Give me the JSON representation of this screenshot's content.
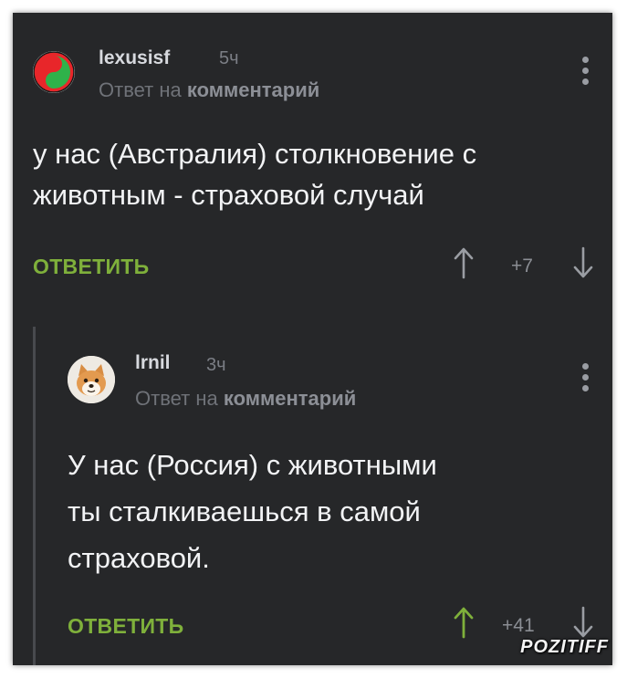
{
  "comments": [
    {
      "author": "lexusisf",
      "time": "5ч",
      "reply_prefix": "Ответ на",
      "reply_target": "комментарий",
      "text_lines": [
        "у нас (Австралия) столкновение с",
        "животным - страховой случай"
      ],
      "reply_label": "ОТВЕТИТЬ",
      "score": "+7"
    },
    {
      "author": "lrnil",
      "time": "3ч",
      "reply_prefix": "Ответ на",
      "reply_target": "комментарий",
      "text_lines": [
        "У нас (Россия) с животными",
        "ты сталкиваешься в самой",
        "страховой."
      ],
      "reply_label": "ОТВЕТИТЬ",
      "score": "+41"
    }
  ],
  "watermark": "POZITIFF",
  "colors": {
    "background": "#262729",
    "accent_green": "#7fb03b",
    "text": "#f2f3f5",
    "muted": "#7b7e85"
  },
  "icons": [
    "yin-yang-avatar-icon",
    "shiba-dog-avatar-icon",
    "more-vertical-icon",
    "arrow-up-icon",
    "arrow-down-icon"
  ]
}
